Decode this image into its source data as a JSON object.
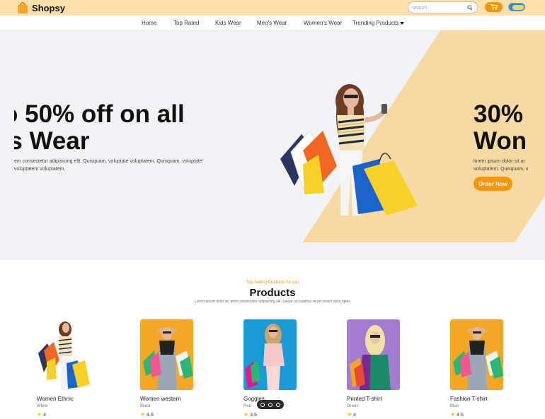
{
  "header": {
    "brand": "Shopsy",
    "search_placeholder": "search",
    "colors": {
      "bar": "#fce0ac",
      "accent": "#f5950e",
      "toggle": "#1c8ee6"
    }
  },
  "nav": {
    "items": [
      "Home",
      "Top Rated",
      "Kids Wear",
      "Men's Wear",
      "Women's Wear",
      "Trending Products"
    ]
  },
  "hero": {
    "slide1_line1": "o 50% off on all",
    "slide1_line2": "'s Wear",
    "slide1_desc": "em consectetur adipisicing elit. Quisquam, voluptate voluptatem. Quisquam, voluptate voluptatem voluptatem.",
    "slide2_line1": "30%",
    "slide2_line2": "Won",
    "slide2_desc_line1": "lorem ipsum dolor sit ar",
    "slide2_desc_line2": "voluptatem. Quisquam, v",
    "order_button": "Order Now"
  },
  "products": {
    "subtitle": "Top Selling Products for you",
    "title": "Products",
    "description": "Lorem ipsum dolor sit, amet consectetur adipisicing elit. Saepe accusamus rerum ipsum dicta optio!",
    "items": [
      {
        "name": "Women Ethnic",
        "color": "White",
        "rating": "4",
        "bg": "#ffffff"
      },
      {
        "name": "Women western",
        "color": "Black",
        "rating": "4.5",
        "bg": "#f5a623"
      },
      {
        "name": "Goggles",
        "color": "Red",
        "rating": "3.5",
        "bg": "#1a9ad6"
      },
      {
        "name": "Printed T-shirt",
        "color": "Green",
        "rating": "4",
        "bg": "#a57bd0"
      },
      {
        "name": "Fashion T-shirt",
        "color": "Blue",
        "rating": "4.5",
        "bg": "#f5a623"
      }
    ]
  }
}
